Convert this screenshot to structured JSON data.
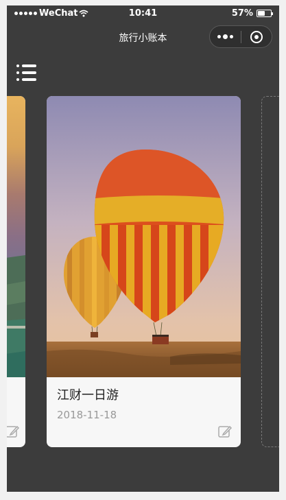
{
  "status_bar": {
    "carrier": "WeChat",
    "time": "10:41",
    "battery_text": "57%",
    "battery_level": 0.57
  },
  "nav": {
    "title": "旅行小账本"
  },
  "colors": {
    "background": "#3c3c3c",
    "card": "#f7f7f7",
    "title_text": "#222222",
    "date_text": "#999999"
  },
  "icons": {
    "menu": "list-icon",
    "more": "more-dots-icon",
    "close": "target-circle-icon",
    "edit": "edit-icon"
  },
  "trips": [
    {
      "title": "江财一日游",
      "date": "2018-11-18"
    }
  ]
}
